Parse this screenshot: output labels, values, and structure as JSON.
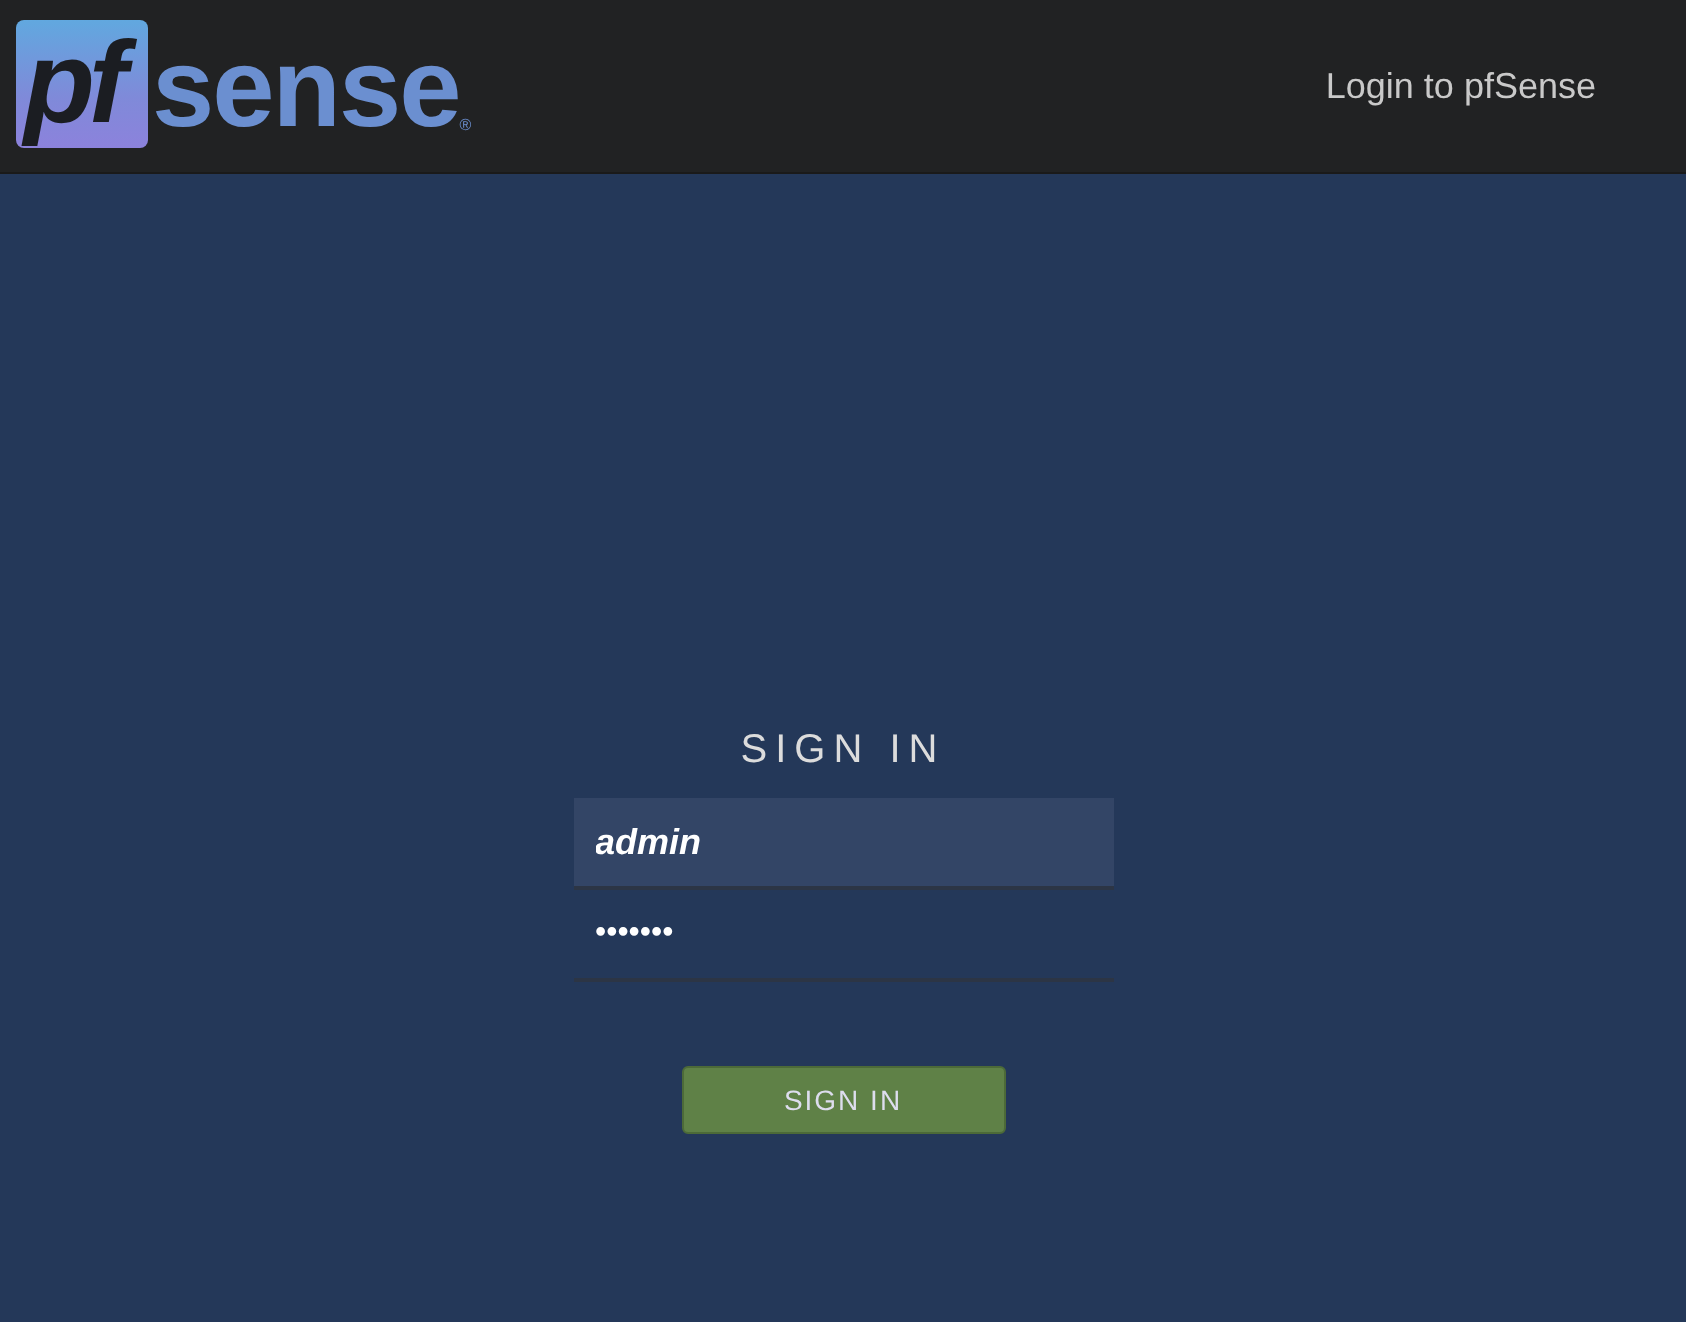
{
  "header": {
    "logo": {
      "mark": "pf",
      "word": "sense",
      "registered": "®"
    },
    "title": "Login to pfSense"
  },
  "login": {
    "heading": "SIGN IN",
    "username": {
      "value": "admin",
      "focused": true
    },
    "password": {
      "value": "•••••••",
      "focused": false
    },
    "button": "SIGN IN"
  }
}
